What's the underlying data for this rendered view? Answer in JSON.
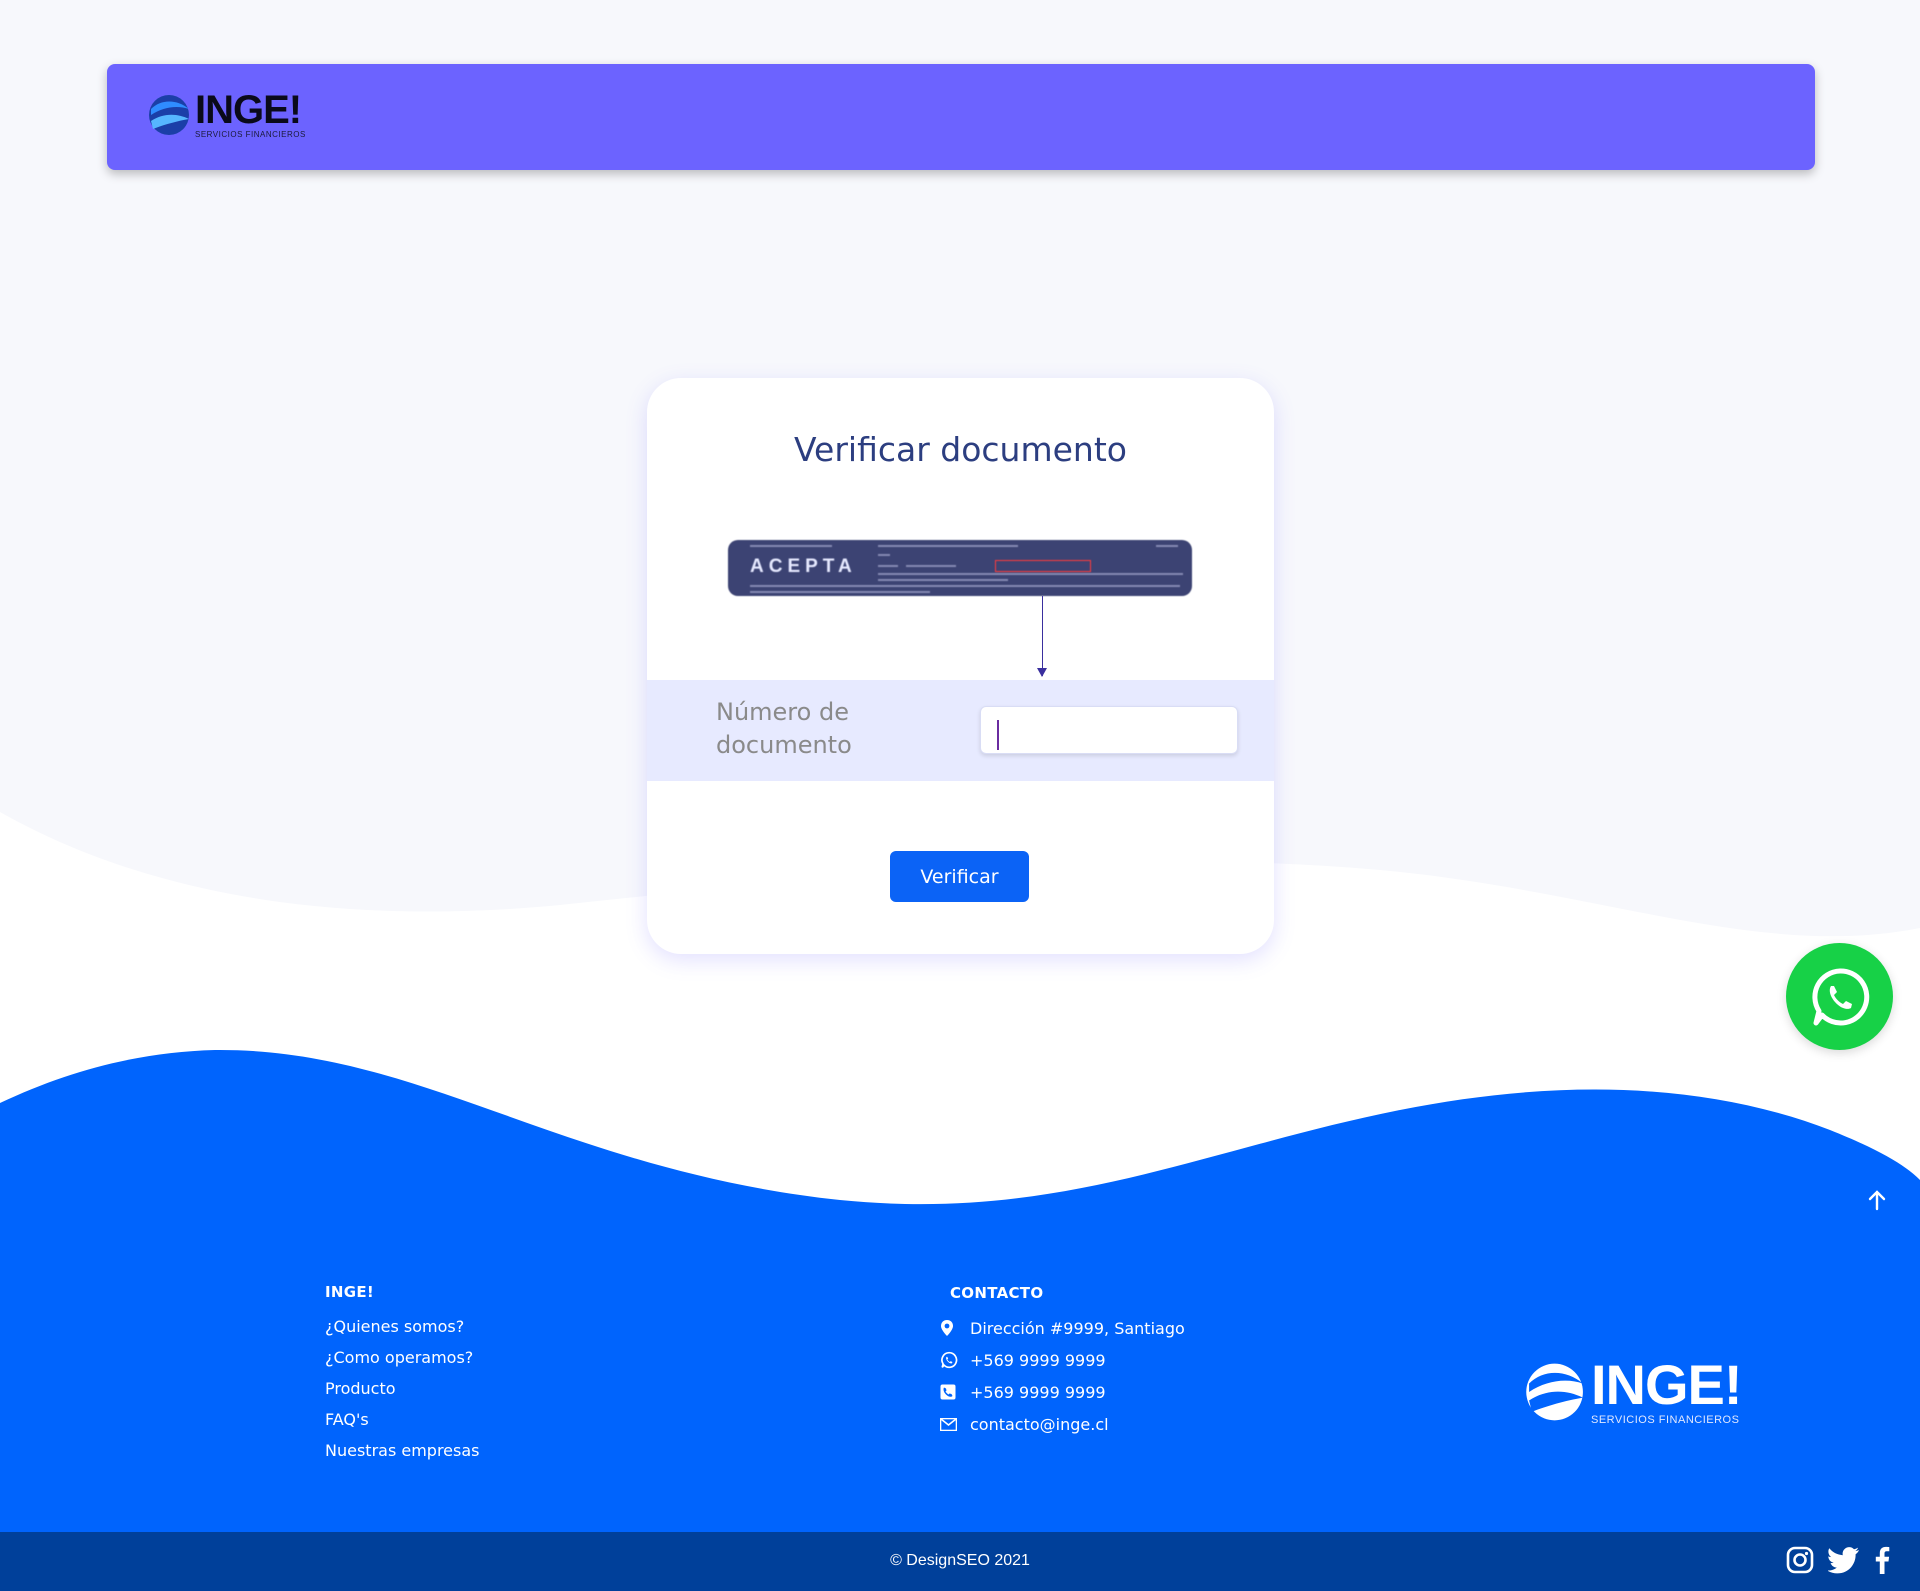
{
  "brand": {
    "name": "INGE!",
    "tagline": "SERVICIOS FINANCIEROS"
  },
  "colors": {
    "header": "#6c63ff",
    "primary": "#0b63f6",
    "footer": "#0064fd",
    "bottom_bar": "#00409a",
    "whatsapp": "#17d147"
  },
  "card": {
    "title": "Verificar documento",
    "sample_brand": "ACEPTA",
    "field_label": "Número de documento",
    "input_value": "",
    "button_label": "Verificar"
  },
  "footer": {
    "left": {
      "heading": "INGE!",
      "links": [
        "¿Quienes somos?",
        "¿Como operamos?",
        "Producto",
        "FAQ's",
        "Nuestras empresas"
      ]
    },
    "contact": {
      "heading": "CONTACTO",
      "address": "Dirección #9999, Santiago",
      "whatsapp": "+569 9999 9999",
      "phone": "+569 9999 9999",
      "email": "contacto@inge.cl"
    },
    "copyright": "© DesignSEO 2021"
  },
  "icons": [
    "whatsapp-icon",
    "arrow-up-icon",
    "location-icon",
    "phone-icon",
    "mail-icon",
    "instagram-icon",
    "twitter-icon",
    "facebook-icon"
  ]
}
